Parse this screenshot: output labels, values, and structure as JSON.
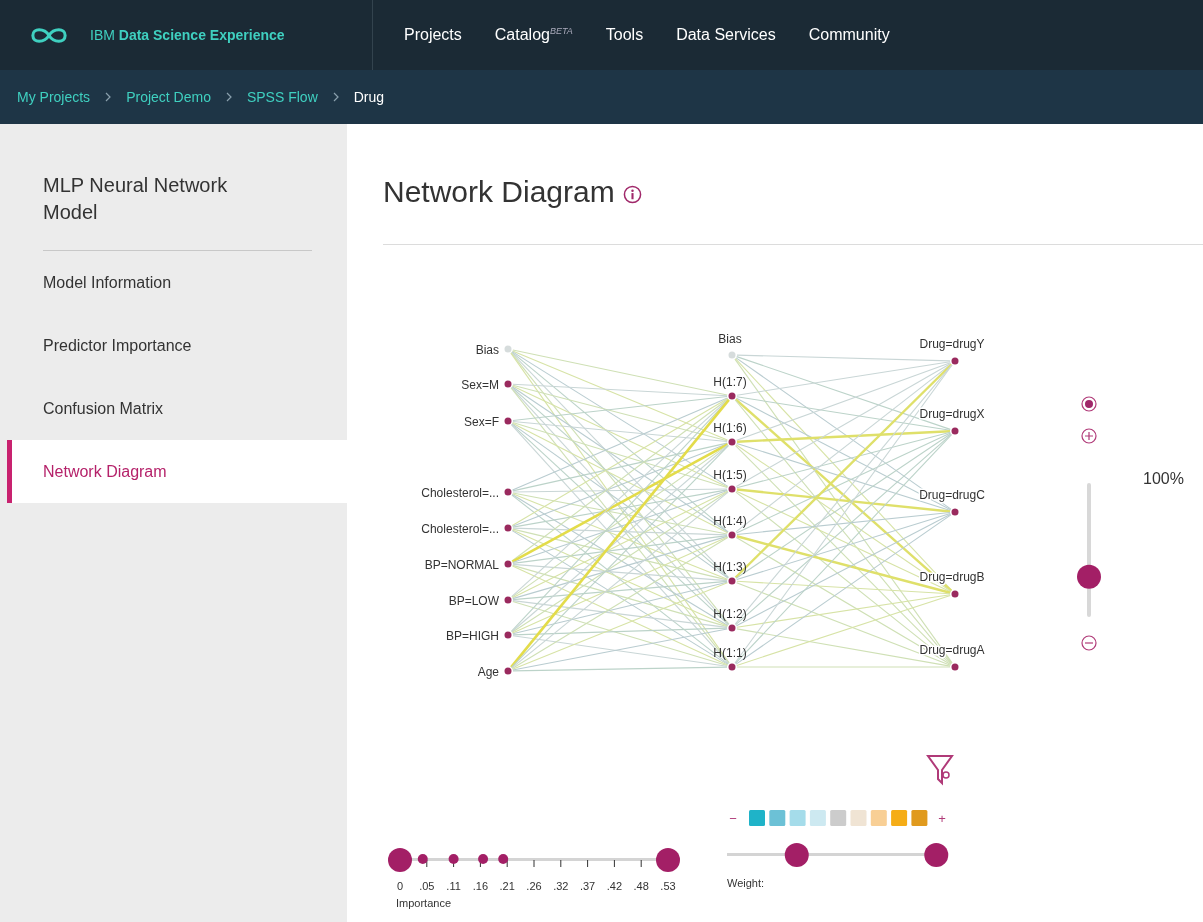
{
  "brand": {
    "name": "IBM **Data Science Experience**"
  },
  "nav": [
    {
      "label": "Projects"
    },
    {
      "label": "Catalog",
      "badge": "BETA"
    },
    {
      "label": "Tools"
    },
    {
      "label": "Data Services"
    },
    {
      "label": "Community"
    }
  ],
  "breadcrumb": [
    {
      "label": "My Projects",
      "current": false
    },
    {
      "label": "Project Demo",
      "current": false
    },
    {
      "label": "SPSS Flow",
      "current": false
    },
    {
      "label": "Drug",
      "current": true
    }
  ],
  "sidebar": {
    "title": "MLP Neural Network Model",
    "items": [
      {
        "label": "Model Information",
        "selected": false
      },
      {
        "label": "Predictor Importance",
        "selected": false
      },
      {
        "label": "Confusion Matrix",
        "selected": false
      },
      {
        "label": "Network Diagram",
        "selected": true
      }
    ]
  },
  "heading": "Network Diagram",
  "network": {
    "input_layer": [
      {
        "label": "Bias",
        "kind": "bias"
      },
      {
        "label": "Sex=M",
        "kind": "unit"
      },
      {
        "label": "Sex=F",
        "kind": "unit"
      },
      {
        "label": "Cholesterol=...",
        "kind": "unit"
      },
      {
        "label": "Cholesterol=...",
        "kind": "unit"
      },
      {
        "label": "BP=NORMAL",
        "kind": "unit"
      },
      {
        "label": "BP=LOW",
        "kind": "unit"
      },
      {
        "label": "BP=HIGH",
        "kind": "unit"
      },
      {
        "label": "Age",
        "kind": "unit"
      }
    ],
    "hidden_layer": [
      {
        "label": "Bias",
        "kind": "bias"
      },
      {
        "label": "H(1:7)",
        "kind": "unit"
      },
      {
        "label": "H(1:6)",
        "kind": "unit"
      },
      {
        "label": "H(1:5)",
        "kind": "unit"
      },
      {
        "label": "H(1:4)",
        "kind": "unit"
      },
      {
        "label": "H(1:3)",
        "kind": "unit"
      },
      {
        "label": "H(1:2)",
        "kind": "unit"
      },
      {
        "label": "H(1:1)",
        "kind": "unit"
      }
    ],
    "output_layer": [
      {
        "label": "Drug=drugY"
      },
      {
        "label": "Drug=drugX"
      },
      {
        "label": "Drug=drugC"
      },
      {
        "label": "Drug=drugB"
      },
      {
        "label": "Drug=drugA"
      }
    ]
  },
  "zoom": {
    "reading": "100%",
    "level": 0.3
  },
  "weight_legend": {
    "minus": "−",
    "plus": "+",
    "swatches": [
      {
        "color": "#1fb3c8"
      },
      {
        "color": "#6cc1d6"
      },
      {
        "color": "#a5dcea"
      },
      {
        "color": "#cde9f1"
      },
      {
        "color": "#cccccc"
      },
      {
        "color": "#f0e4d4"
      },
      {
        "color": "#f8cf95"
      },
      {
        "color": "#f5ad17"
      },
      {
        "color": "#e09a1e"
      }
    ]
  },
  "weight_slider": {
    "label": "Weight:",
    "low": {
      "level": 0.32
    },
    "high": {
      "level": 0.96
    }
  },
  "importance_slider": {
    "label": "Importance",
    "low": {
      "level": 0
    },
    "high": {
      "level": 1
    },
    "markers": [
      {
        "level": 0.085
      },
      {
        "level": 0.2
      },
      {
        "level": 0.31
      },
      {
        "level": 0.385
      }
    ],
    "ticks": [
      "0",
      ".05",
      ".11",
      ".16",
      ".21",
      ".26",
      ".32",
      ".37",
      ".42",
      ".48",
      ".53"
    ]
  }
}
